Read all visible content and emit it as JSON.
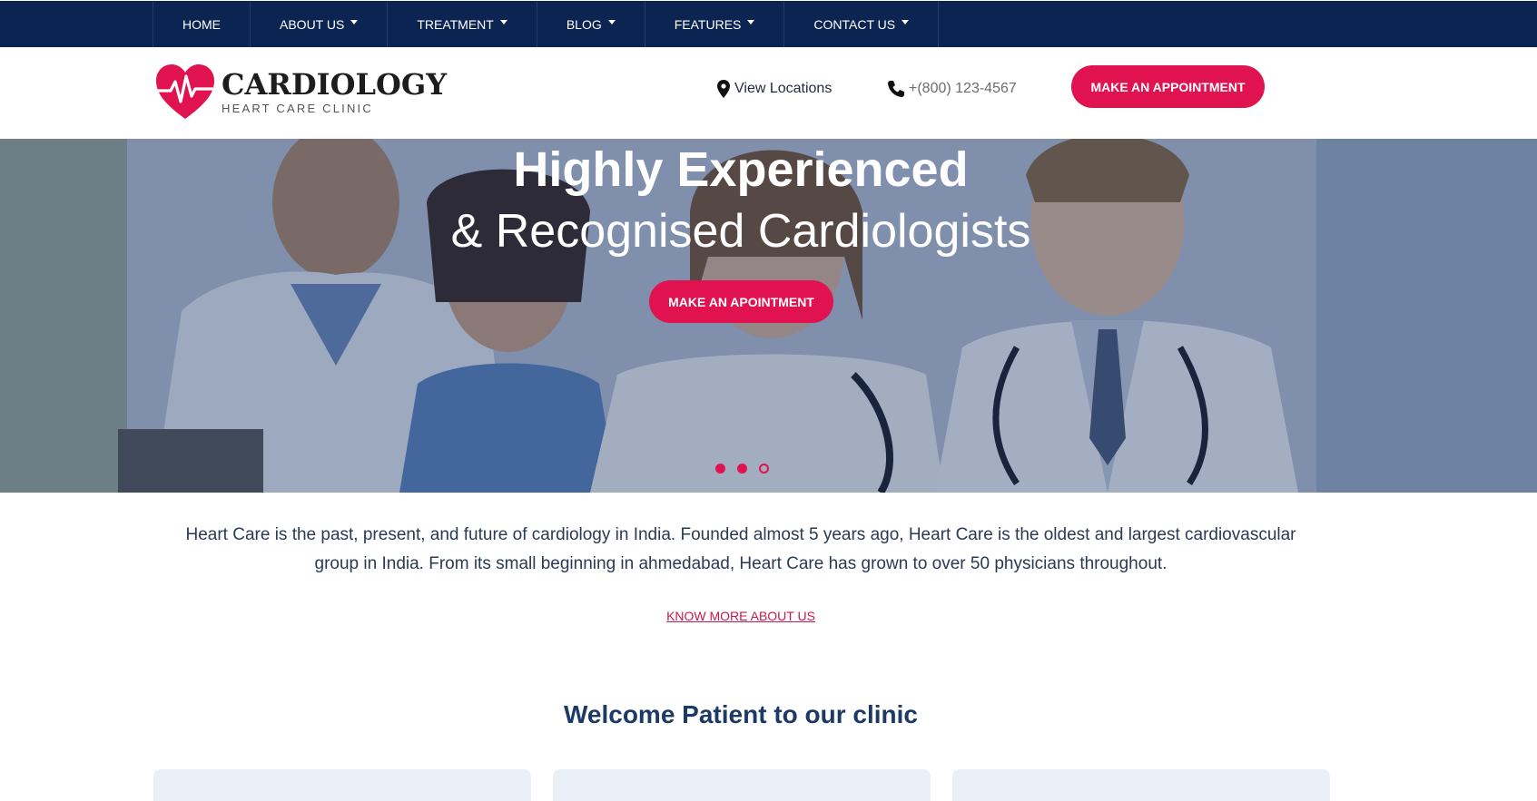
{
  "nav": {
    "items": [
      {
        "label": "HOME",
        "has_dropdown": false
      },
      {
        "label": "ABOUT US",
        "has_dropdown": true
      },
      {
        "label": "TREATMENT",
        "has_dropdown": true
      },
      {
        "label": "BLOG",
        "has_dropdown": true
      },
      {
        "label": "FEATURES",
        "has_dropdown": true
      },
      {
        "label": "CONTACT US",
        "has_dropdown": true
      }
    ]
  },
  "header": {
    "logo_title": "CARDIOLOGY",
    "logo_subtitle": "HEART CARE CLINIC",
    "location_icon": "map-pin-icon",
    "location_label": "View Locations",
    "phone_icon": "phone-icon",
    "phone": "+(800) 123-4567",
    "cta_label": "MAKE AN APPOINTMENT"
  },
  "hero": {
    "headline": "Highly Experienced",
    "subheadline": "& Recognised Cardiologists",
    "cta_label": "MAKE AN APOINTMENT",
    "slides": [
      {
        "active": true
      },
      {
        "active": true
      },
      {
        "active": false
      }
    ]
  },
  "intro": {
    "text": "Heart Care is the past, present, and future of cardiology in India. Founded almost 5 years ago, Heart Care is the oldest and largest cardiovascular group in India. From its small beginning in ahmedabad, Heart Care has grown to over 50 physicians throughout.",
    "link_label": "KNOW MORE ABOUT US"
  },
  "welcome": {
    "title": "Welcome Patient to our clinic"
  },
  "colors": {
    "nav_bg": "#0b2452",
    "accent": "#e0124f",
    "text_dark": "#1d3a66"
  }
}
